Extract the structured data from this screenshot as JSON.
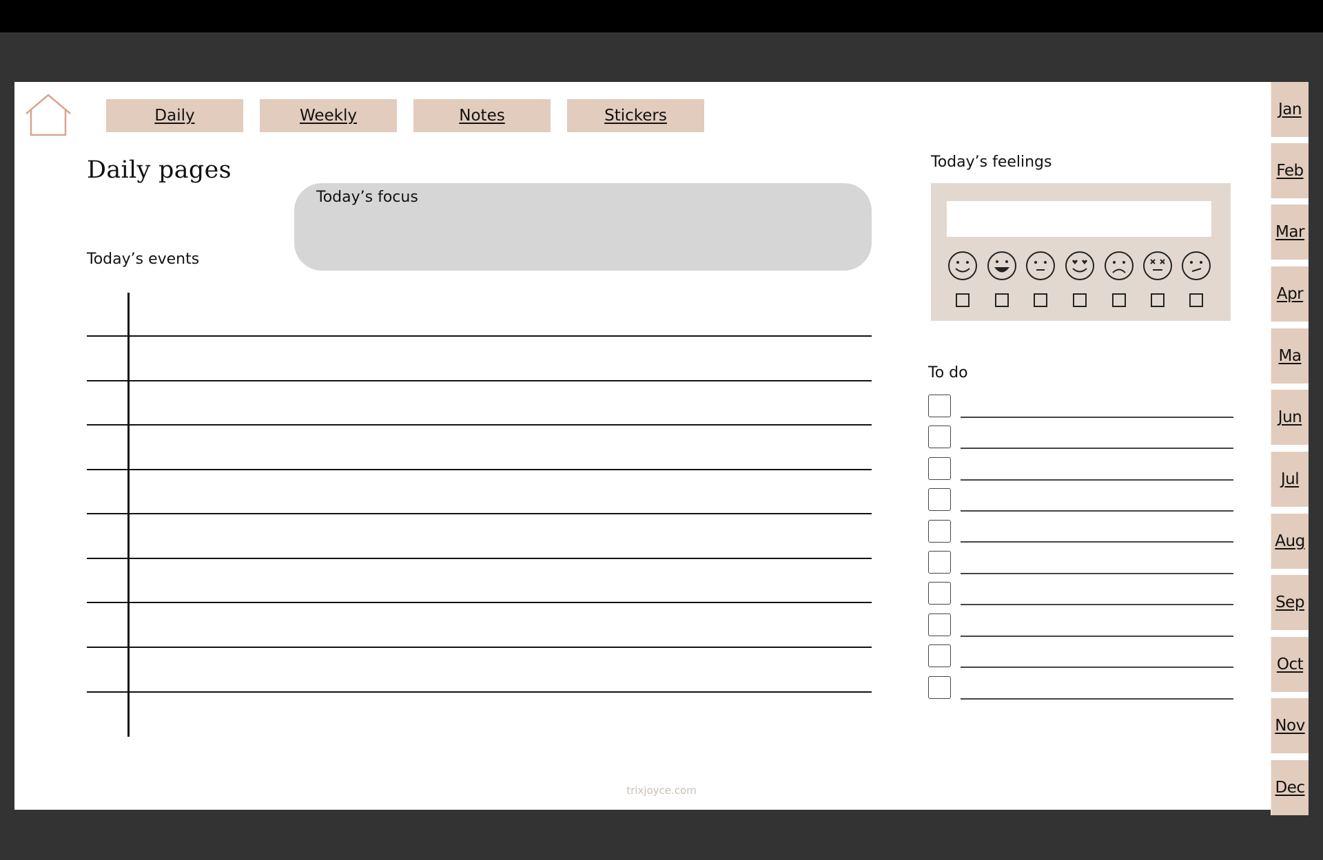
{
  "nav": {
    "home_icon": "house-outline-icon",
    "buttons": [
      {
        "label": "Daily"
      },
      {
        "label": "Weekly"
      },
      {
        "label": "Notes"
      },
      {
        "label": "Stickers"
      }
    ]
  },
  "page": {
    "title": "Daily pages",
    "focus_label": "Today’s focus",
    "events_label": "Today’s events",
    "events_rows": 9
  },
  "feelings": {
    "label": "Today’s feelings",
    "input_value": "",
    "faces": [
      "smile-face-icon",
      "grin-face-icon",
      "neutral-face-icon",
      "heart-eyes-face-icon",
      "sad-face-icon",
      "dizzy-face-icon",
      "confused-face-icon"
    ]
  },
  "todo": {
    "label": "To do",
    "items": 10
  },
  "watermark": "trixjoyce.com",
  "months": [
    "Jan",
    "Feb",
    "Mar",
    "Apr",
    "Ma",
    "Jun",
    "Jul",
    "Aug",
    "Sep",
    "Oct",
    "Nov",
    "Dec"
  ],
  "colors": {
    "accent": "#e2ccbd",
    "home_icon": "#d9a58c",
    "focus_bg": "#d6d6d6",
    "feelings_bg": "#e2d8cf",
    "frame": "#333333"
  }
}
